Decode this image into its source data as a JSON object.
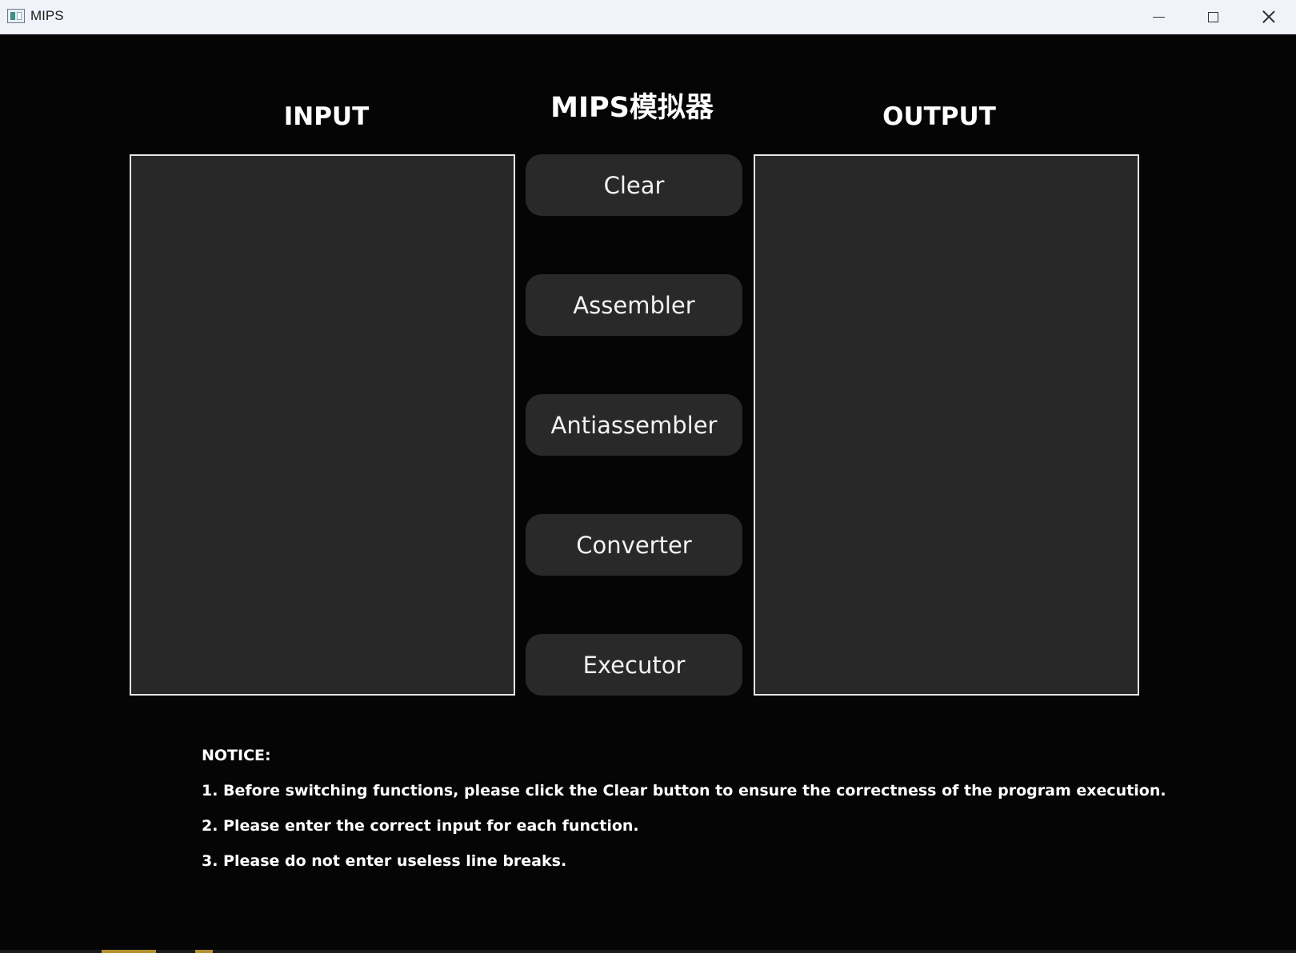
{
  "window": {
    "title": "MIPS"
  },
  "headings": {
    "input": "INPUT",
    "app_title": "MIPS模拟器",
    "output": "OUTPUT"
  },
  "input_area": {
    "value": "",
    "placeholder": ""
  },
  "output_area": {
    "value": "",
    "placeholder": ""
  },
  "buttons": {
    "clear": "Clear",
    "assembler": "Assembler",
    "antiassembler": "Antiassembler",
    "converter": "Converter",
    "executor": "Executor"
  },
  "notice": {
    "title": "NOTICE:",
    "items": [
      "1. Before switching functions, please click the Clear button to ensure the correctness of the program execution.",
      "2. Please enter the correct input for each function.",
      "3. Please do not enter useless line breaks."
    ]
  },
  "colors": {
    "background": "#050505",
    "panel": "#282828",
    "button": "#292929",
    "text": "#ffffff"
  },
  "icons": {
    "app": "app-window-icon",
    "minimize": "minimize-icon",
    "maximize": "maximize-icon",
    "close": "close-icon"
  }
}
